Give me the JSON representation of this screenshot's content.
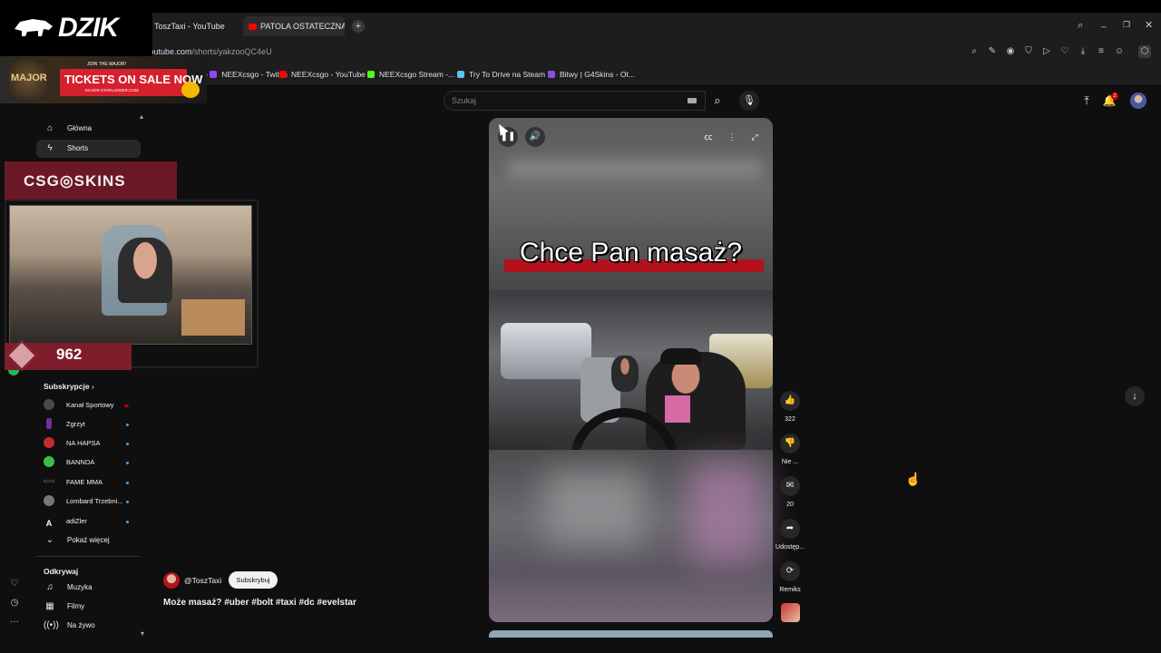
{
  "browser": {
    "tabs": [
      {
        "label": "ToszTaxi - YouTube"
      },
      {
        "label": "PATOLA OSTATECZNA! M..."
      }
    ],
    "new_tab_icon": "plus-icon",
    "url_domain": "youtube.com",
    "url_path": "/shorts/yakzooQC4eU",
    "bookmarks": [
      {
        "label": "NEEXcsgo - Twitch",
        "color": "#9146ff",
        "prefix": ")"
      },
      {
        "label": "NEEXcsgo - YouTube",
        "color": "#ff0000"
      },
      {
        "label": "NEEXcsgo Stream -...",
        "color": "#53fc18"
      },
      {
        "label": "Try To Drive na Steam",
        "color": "#66c0f4"
      },
      {
        "label": "Bitwy | G4Skins - Ot...",
        "color": "#8a4de0"
      }
    ]
  },
  "youtube": {
    "search_placeholder": "Szukaj",
    "notifications_count": "2",
    "sidebar": {
      "top": [
        {
          "label": "Główna",
          "icon": "home-icon"
        },
        {
          "label": "Shorts",
          "icon": "shorts-icon"
        }
      ],
      "subscriptions_title": "Subskrypcje",
      "subscriptions": [
        {
          "label": "Kanał Sportowy",
          "color": "#4a4a4a",
          "live": true
        },
        {
          "label": "Zgrzyt",
          "color": "#6b2fa0"
        },
        {
          "label": "NA HAPSA",
          "color": "#c22c2c"
        },
        {
          "label": "BANNDA",
          "color": "#3bbf4a"
        },
        {
          "label": "FAME MMA",
          "color": "#111111"
        },
        {
          "label": "Lombard Trzebni...",
          "color": "#777777"
        },
        {
          "label": "adiZler",
          "color": "#222222"
        }
      ],
      "show_more": "Pokaż więcej",
      "explore_title": "Odkrywaj",
      "explore": [
        {
          "label": "Muzyka",
          "icon": "music-icon"
        },
        {
          "label": "Filmy",
          "icon": "film-icon"
        },
        {
          "label": "Na żywo",
          "icon": "live-icon"
        }
      ]
    },
    "short": {
      "caption": "Chce Pan masaż?",
      "channel": "@ToszTaxi",
      "subscribe": "Subskrybuj",
      "title": "Może masaż? #uber #bolt #taxi #dc #evelstar",
      "likes": "322",
      "dislike_label": "Nie ...",
      "comments": "20",
      "share_label": "Udostęp...",
      "remix_label": "Remiks"
    }
  },
  "overlay": {
    "brand": "DZIK",
    "major_join": "JOIN THE MAJOR!",
    "major_ticket": "TICKETS ON SALE NOW",
    "major_site": "MAJOR.STARLADDER.COM",
    "major_logo": "MAJOR",
    "sponsor": "CSG◎SKINS",
    "viewers": "962"
  }
}
